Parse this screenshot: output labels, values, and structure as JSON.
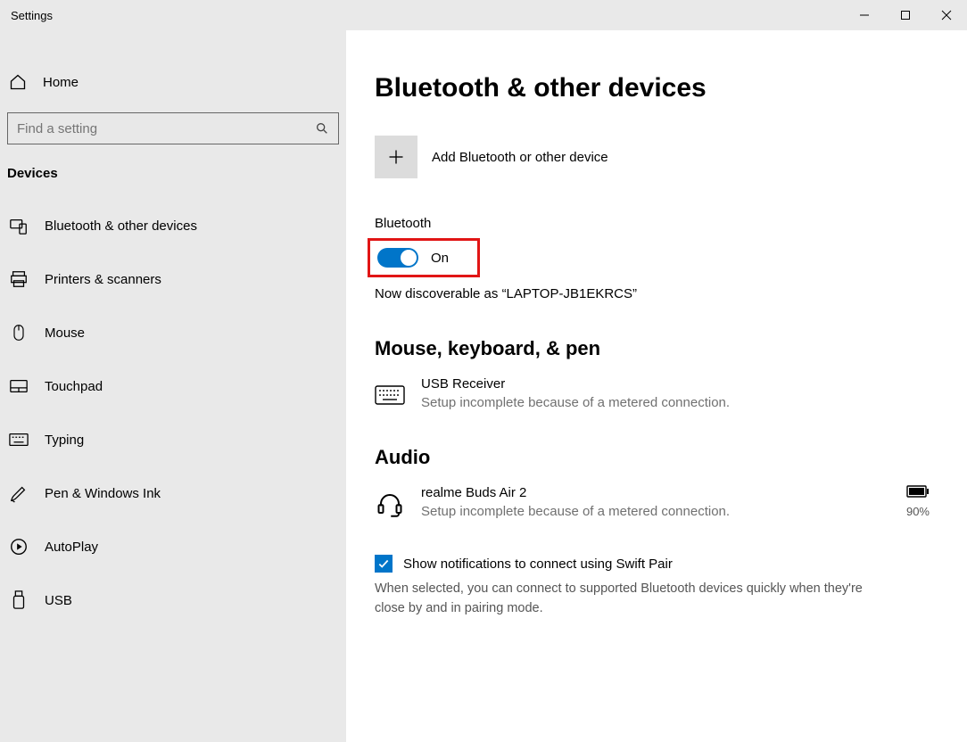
{
  "window": {
    "title": "Settings"
  },
  "sidebar": {
    "home_label": "Home",
    "search_placeholder": "Find a setting",
    "section_label": "Devices",
    "items": [
      {
        "label": "Bluetooth & other devices"
      },
      {
        "label": "Printers & scanners"
      },
      {
        "label": "Mouse"
      },
      {
        "label": "Touchpad"
      },
      {
        "label": "Typing"
      },
      {
        "label": "Pen & Windows Ink"
      },
      {
        "label": "AutoPlay"
      },
      {
        "label": "USB"
      }
    ]
  },
  "main": {
    "title": "Bluetooth & other devices",
    "add_device_label": "Add Bluetooth or other device",
    "bluetooth_label": "Bluetooth",
    "toggle_state": "On",
    "discoverable_text": "Now discoverable as “LAPTOP-JB1EKRCS”",
    "mouse_section": "Mouse, keyboard, & pen",
    "usb_receiver": {
      "name": "USB Receiver",
      "sub": "Setup incomplete because of a metered connection."
    },
    "audio_section": "Audio",
    "audio_device": {
      "name": "realme Buds Air 2",
      "sub": "Setup incomplete because of a metered connection.",
      "battery": "90%"
    },
    "swift_pair_label": "Show notifications to connect using Swift Pair",
    "swift_pair_desc": "When selected, you can connect to supported Bluetooth devices quickly when they're close by and in pairing mode."
  }
}
